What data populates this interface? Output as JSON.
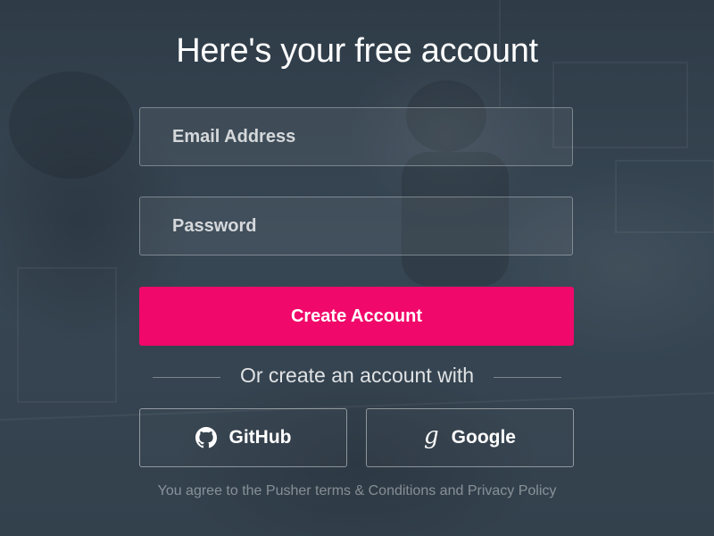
{
  "page": {
    "title": "Here's your free account"
  },
  "form": {
    "email_placeholder": "Email Address",
    "email_value": "",
    "password_placeholder": "Password",
    "password_value": "",
    "submit_label": "Create Account"
  },
  "alternatives": {
    "divider_text": "Or create an account with",
    "github_label": "GitHub",
    "github_icon": "github-icon",
    "google_label": "Google",
    "google_icon": "google-g-icon",
    "google_glyph": "g"
  },
  "footer": {
    "prefix": "You agree to the Pusher ",
    "terms_link": "terms & Conditions",
    "conjunction": " and ",
    "privacy_link": "Privacy Policy"
  },
  "colors": {
    "background": "#34424f",
    "accent": "#f0086a",
    "text": "#ffffff"
  }
}
